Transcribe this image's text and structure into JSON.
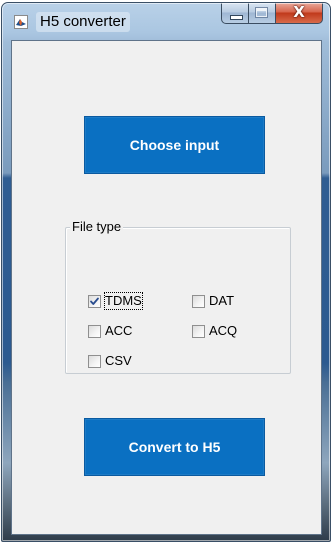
{
  "window": {
    "title": "H5 converter",
    "icon": "matlab-figure-icon",
    "controls": {
      "minimize": "minimize-icon",
      "maximize": "maximize-icon",
      "close": "X"
    }
  },
  "buttons": {
    "choose_input": "Choose input",
    "convert": "Convert to H5"
  },
  "file_type": {
    "legend": "File type",
    "options": [
      {
        "label": "TDMS",
        "checked": true
      },
      {
        "label": "ACC",
        "checked": false
      },
      {
        "label": "CSV",
        "checked": false
      },
      {
        "label": "DAT",
        "checked": false
      },
      {
        "label": "ACQ",
        "checked": false
      }
    ]
  },
  "colors": {
    "button_bg": "#0a70c2",
    "button_text": "#ffffff",
    "client_bg": "#f0f0f0",
    "close_button": "#c7402a"
  }
}
